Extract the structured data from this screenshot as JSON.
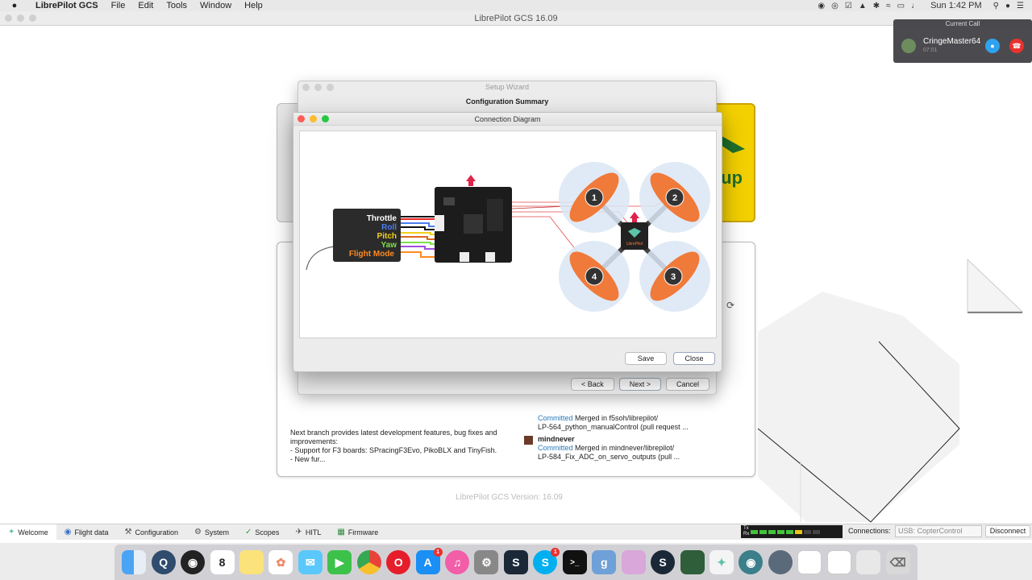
{
  "menubar": {
    "app_name": "LibrePilot GCS",
    "items": [
      "File",
      "Edit",
      "Tools",
      "Window",
      "Help"
    ],
    "clock": "Sun 1:42 PM"
  },
  "main_window": {
    "title": "LibrePilot GCS 16.09"
  },
  "welcome": {
    "card_text": "up",
    "news_text": "Next branch provides latest development features, bug fixes and improvements:\n - Support for F3 boards: SPracingF3Evo, PikoBLX and TinyFish.\n - New fur...",
    "commits": [
      {
        "user": "",
        "status": "Committed",
        "message": "Merged in f5soh/librepilot/",
        "detail": "LP-564_python_manualControl (pull request ..."
      },
      {
        "user": "mindnever",
        "status": "Committed",
        "message": "Merged in mindnever/librepilot/",
        "detail": "LP-584_Fix_ADC_on_servo_outputs (pull ..."
      }
    ],
    "version": "LibrePilot GCS Version: 16.09"
  },
  "setup_wizard": {
    "title": "Setup Wizard",
    "subtitle": "Configuration Summary",
    "back_label": "< Back",
    "next_label": "Next >",
    "cancel_label": "Cancel"
  },
  "connection_dialog": {
    "title": "Connection Diagram",
    "save_label": "Save",
    "close_label": "Close",
    "receiver_channels": [
      "Throttle",
      "Roll",
      "Pitch",
      "Yaw",
      "Flight Mode"
    ],
    "channel_colors": [
      "#ffffff",
      "#4a7df0",
      "#f2d21a",
      "#7ee04a",
      "#ff8a1f"
    ],
    "motor_numbers": [
      "1",
      "2",
      "3",
      "4"
    ],
    "center_label": "LibrePilot"
  },
  "modebar": {
    "tabs": [
      "Welcome",
      "Flight data",
      "Configuration",
      "System",
      "Scopes",
      "HITL",
      "Firmware"
    ],
    "meter_tx": "Tx",
    "meter_rx": "Rx",
    "connections_label": "Connections:",
    "connection_value": "USB: CopterControl",
    "disconnect_label": "Disconnect"
  },
  "call": {
    "header": "Current Call",
    "name": "CringeMaster64",
    "duration": "07:01"
  },
  "dock": {
    "calendar_day": "8",
    "badges": {
      "appstore": "1",
      "skype": "1"
    }
  }
}
